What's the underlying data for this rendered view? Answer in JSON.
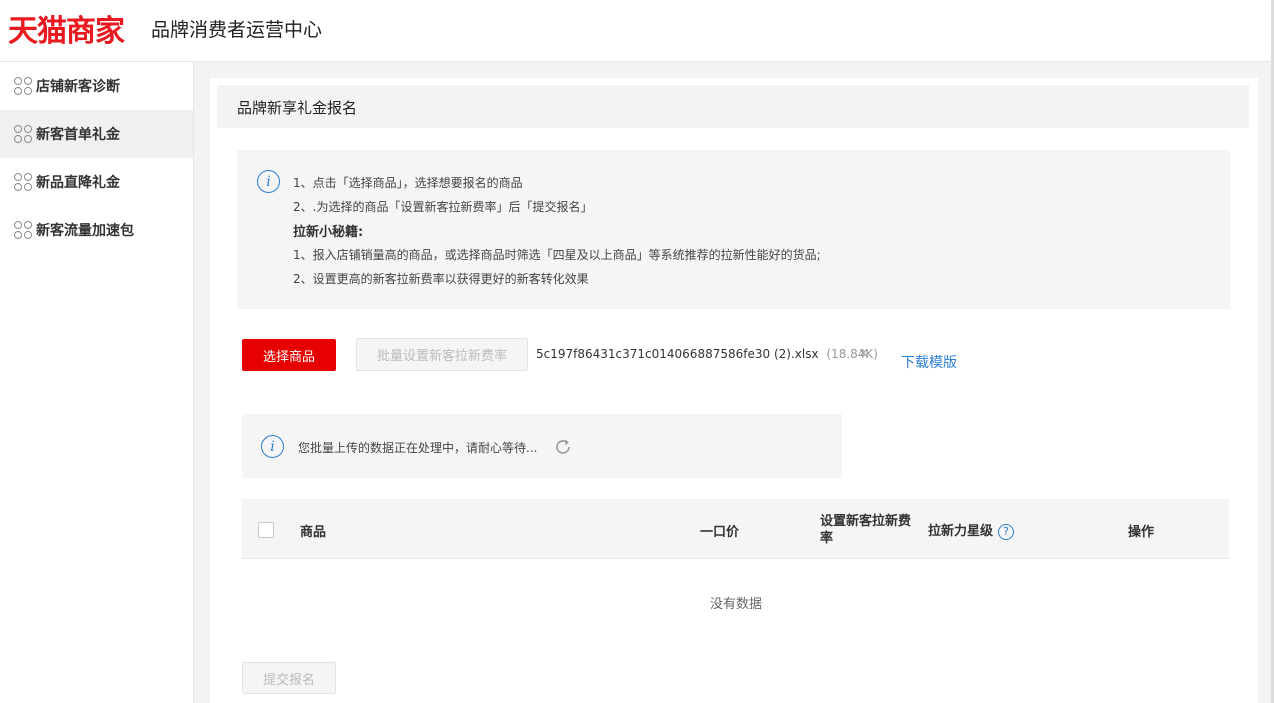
{
  "header": {
    "logo": "天猫商家",
    "title": "品牌消费者运营中心"
  },
  "sidebar": {
    "items": [
      {
        "label": "店铺新客诊断",
        "icon": "clover-icon",
        "active": false
      },
      {
        "label": "新客首单礼金",
        "icon": "clover-icon",
        "active": true
      },
      {
        "label": "新品直降礼金",
        "icon": "clover-icon",
        "active": false
      },
      {
        "label": "新客流量加速包",
        "icon": "clover-icon",
        "active": false
      }
    ]
  },
  "page": {
    "title": "品牌新享礼金报名"
  },
  "notice": {
    "icon": "info-icon",
    "line1": "1、点击「选择商品」，选择想要报名的商品",
    "line2": "2、.为选择的商品「设置新客拉新费率」后「提交报名」",
    "tips_title": "拉新小秘籍:",
    "tip1": "1、报入店铺销量高的商品，或选择商品时筛选「四星及以上商品」等系统推荐的拉新性能好的货品;",
    "tip2": "2、设置更高的新客拉新费率以获得更好的新客转化效果"
  },
  "toolbar": {
    "select_label": "选择商品",
    "batch_label": "批量设置新客拉新费率",
    "file_name": "5c197f86431c371c014066887586fe30 (2).xlsx",
    "file_size": "(18.84K)",
    "close_glyph": "×",
    "download_label": "下载模版"
  },
  "processing": {
    "text": "您批量上传的数据正在处理中，请耐心等待..."
  },
  "table": {
    "columns": [
      "商品",
      "一口价",
      "设置新客拉新费率",
      "拉新力星级",
      "操作"
    ],
    "help_glyph": "?",
    "empty_text": "没有数据"
  },
  "footer": {
    "submit_label": "提交报名"
  },
  "colors": {
    "brand_red": "#e60000",
    "link_blue": "#2b7fd4"
  }
}
